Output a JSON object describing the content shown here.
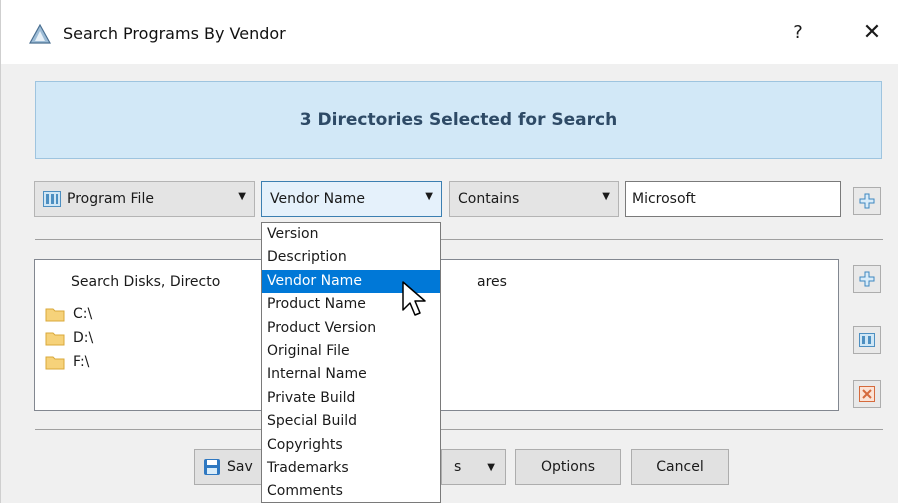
{
  "window": {
    "title": "Search Programs By Vendor",
    "help_label": "?",
    "close_label": "✕"
  },
  "banner": {
    "text": "3 Directories Selected for Search"
  },
  "filter": {
    "field": "Program File",
    "property": "Vendor Name",
    "operator": "Contains",
    "value": "Microsoft"
  },
  "dropdown": {
    "items": [
      "Version",
      "Description",
      "Vendor Name",
      "Product Name",
      "Product Version",
      "Original File",
      "Internal Name",
      "Private Build",
      "Special Build",
      "Copyrights",
      "Trademarks",
      "Comments"
    ],
    "selected": "Vendor Name"
  },
  "directories": {
    "header_left": "Search Disks, Directo",
    "header_right": "ares",
    "items": [
      "C:\\",
      "D:\\",
      "F:\\"
    ]
  },
  "buttons": {
    "save_partial": "Sav",
    "hidden_partial": "s",
    "options": "Options",
    "cancel": "Cancel"
  },
  "colors": {
    "accent": "#0078d7",
    "banner_bg": "#d2e8f7",
    "banner_text": "#2e4a66"
  }
}
